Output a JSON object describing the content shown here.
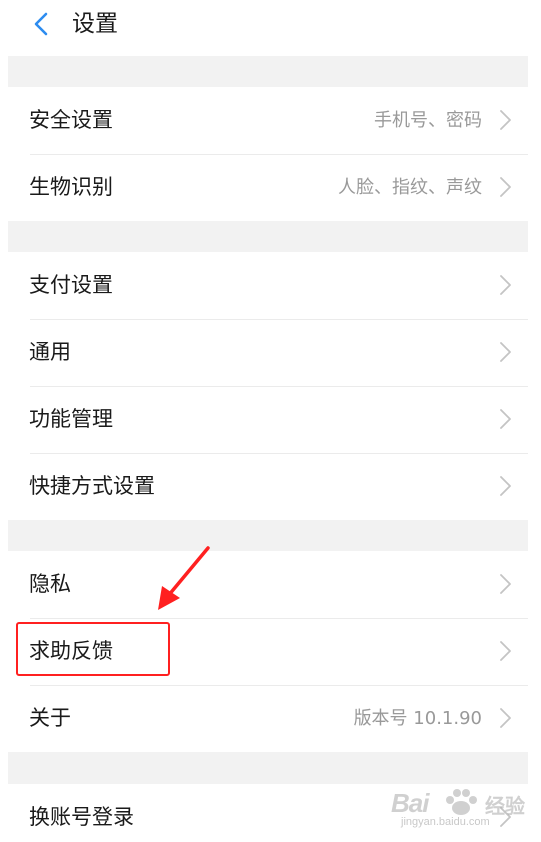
{
  "header": {
    "title": "设置",
    "back_icon": "chevron-left-icon"
  },
  "colors": {
    "accent": "#2d8cf0",
    "annotation": "#ff2020",
    "background": "#f2f2f2"
  },
  "sections": [
    {
      "items": [
        {
          "label": "安全设置",
          "value": "手机号、密码"
        },
        {
          "label": "生物识别",
          "value": "人脸、指纹、声纹"
        }
      ]
    },
    {
      "items": [
        {
          "label": "支付设置",
          "value": ""
        },
        {
          "label": "通用",
          "value": ""
        },
        {
          "label": "功能管理",
          "value": ""
        },
        {
          "label": "快捷方式设置",
          "value": ""
        }
      ]
    },
    {
      "items": [
        {
          "label": "隐私",
          "value": ""
        },
        {
          "label": "求助反馈",
          "value": ""
        },
        {
          "label": "关于",
          "value": "版本号 10.1.90"
        }
      ]
    },
    {
      "items": [
        {
          "label": "换账号登录",
          "value": ""
        }
      ]
    }
  ],
  "watermark": {
    "brand": "Bai",
    "sub": "经验",
    "url": "jingyan.baidu.com"
  }
}
